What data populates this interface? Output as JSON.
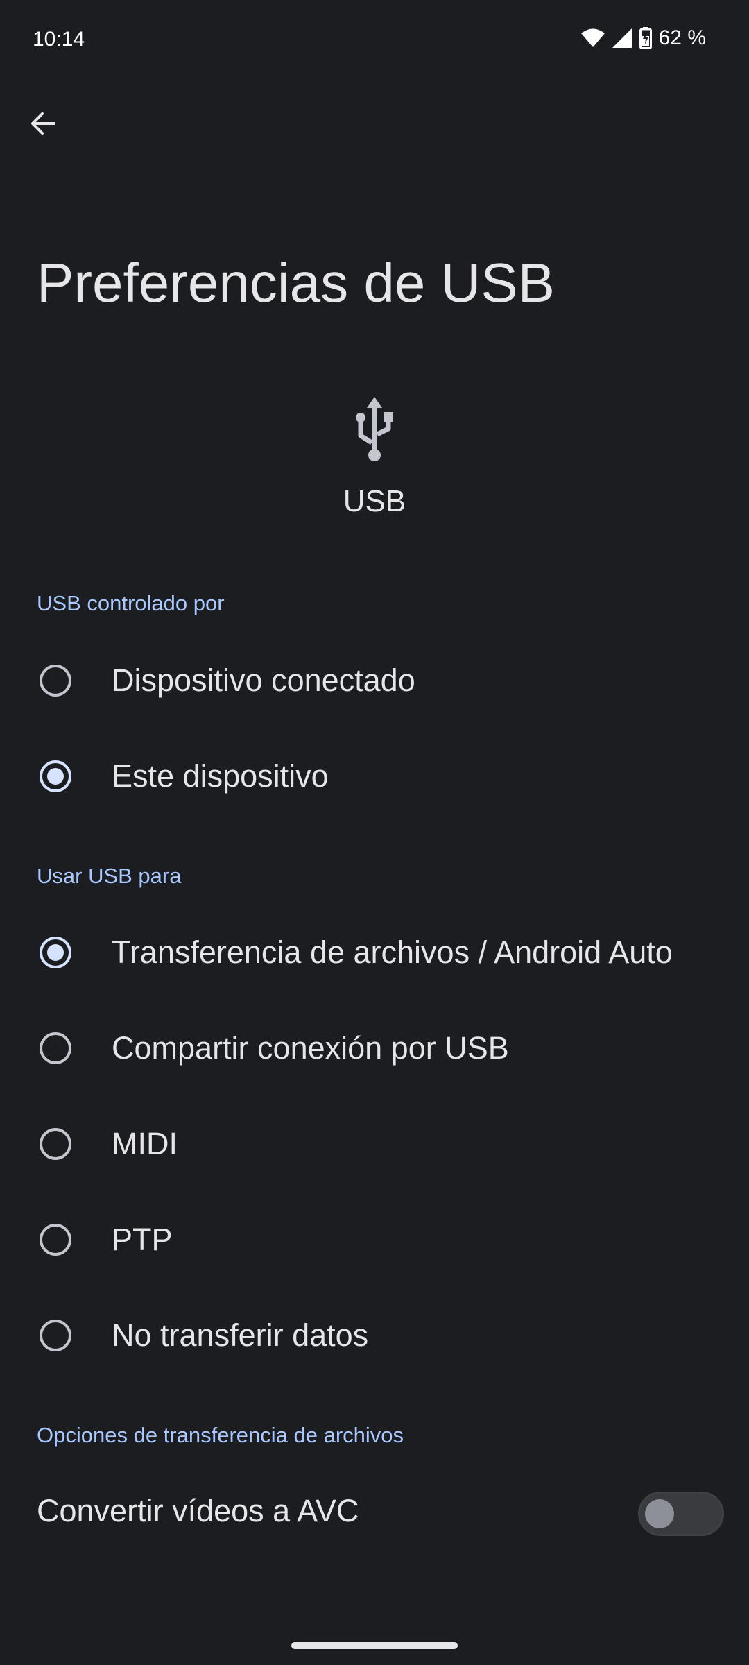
{
  "status_bar": {
    "time": "10:14",
    "battery": "62 %",
    "icons": [
      "wifi-icon",
      "signal-icon",
      "battery-charging-icon"
    ]
  },
  "header": {
    "back_icon": "arrow-back-icon",
    "title": "Preferencias de USB"
  },
  "hero": {
    "icon": "usb-icon",
    "label": "USB"
  },
  "sections": {
    "controlled_by": {
      "header": "USB controlado por",
      "options": [
        {
          "label": "Dispositivo conectado",
          "selected": false
        },
        {
          "label": "Este dispositivo",
          "selected": true
        }
      ]
    },
    "use_for": {
      "header": "Usar USB para",
      "options": [
        {
          "label": "Transferencia de archivos / Android Auto",
          "selected": true
        },
        {
          "label": "Compartir conexión por USB",
          "selected": false
        },
        {
          "label": "MIDI",
          "selected": false
        },
        {
          "label": "PTP",
          "selected": false
        },
        {
          "label": "No transferir datos",
          "selected": false
        }
      ]
    },
    "file_transfer": {
      "header": "Opciones de transferencia de archivos",
      "toggle_label": "Convertir vídeos a AVC",
      "toggle_on": false
    }
  },
  "colors": {
    "background": "#1c1d20",
    "accent": "#a8c8ff",
    "text": "#e6e6e9"
  }
}
